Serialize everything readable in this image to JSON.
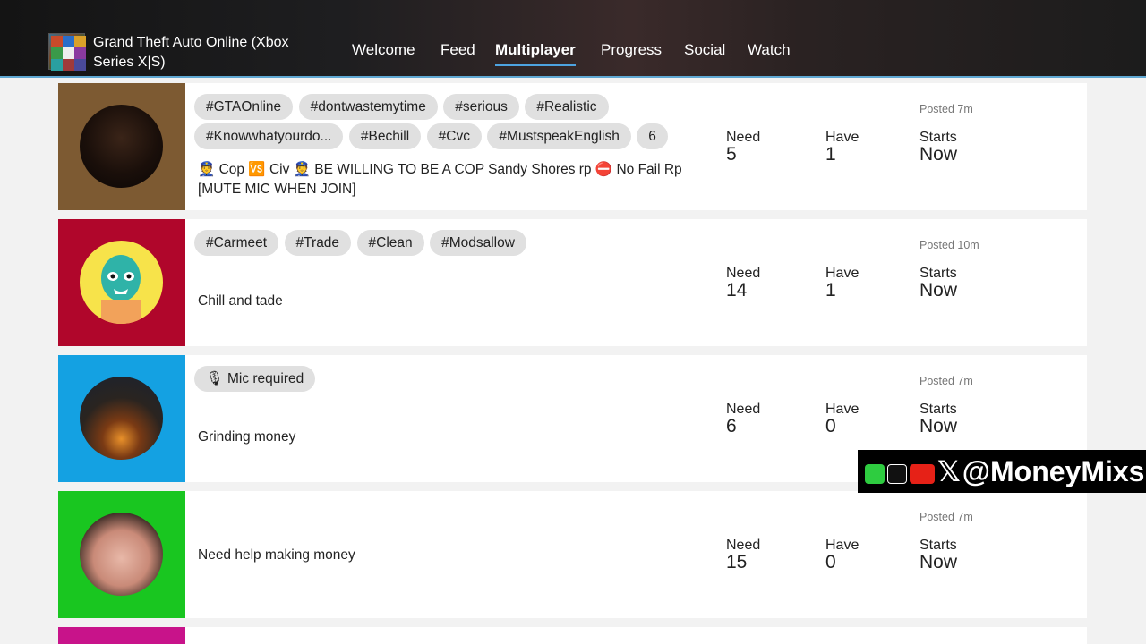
{
  "header": {
    "game_title": "Grand Theft Auto Online (Xbox Series X|S)",
    "tabs": [
      {
        "label": "Welcome",
        "active": false
      },
      {
        "label": "Feed",
        "active": false
      },
      {
        "label": "Multiplayer",
        "active": true
      },
      {
        "label": "Progress",
        "active": false
      },
      {
        "label": "Social",
        "active": false
      },
      {
        "label": "Watch",
        "active": false
      }
    ]
  },
  "labels": {
    "need": "Need",
    "have": "Have",
    "starts": "Starts"
  },
  "posts": [
    {
      "bg_color": "#7d5a32",
      "tags": [
        "#GTAOnline",
        "#dontwastemytime",
        "#serious",
        "#Realistic",
        "#Knowwhatyourdo...",
        "#Bechill",
        "#Cvc",
        "#MustspeakEnglish",
        "6"
      ],
      "description": "👮 Cop 🆚 Civ 👮 BE WILLING TO BE A COP Sandy Shores rp ⛔ No Fail Rp [MUTE MIC WHEN JOIN]",
      "need": "5",
      "have": "1",
      "starts": "Now",
      "posted": "Posted 7m"
    },
    {
      "bg_color": "#b0062b",
      "tags": [
        "#Carmeet",
        "#Trade",
        "#Clean",
        "#Modsallow"
      ],
      "description": "Chill and tade",
      "need": "14",
      "have": "1",
      "starts": "Now",
      "posted": "Posted 10m"
    },
    {
      "bg_color": "#14a1e2",
      "tags": [
        "🎙 Mic required"
      ],
      "description": "Grinding money",
      "need": "6",
      "have": "0",
      "starts": "Now",
      "posted": "Posted 7m"
    },
    {
      "bg_color": "#19c620",
      "tags": [],
      "description": "Need help making money",
      "need": "15",
      "have": "0",
      "starts": "Now",
      "posted": "Posted 7m"
    }
  ],
  "watermark": {
    "text": "@MoneyMixs"
  }
}
